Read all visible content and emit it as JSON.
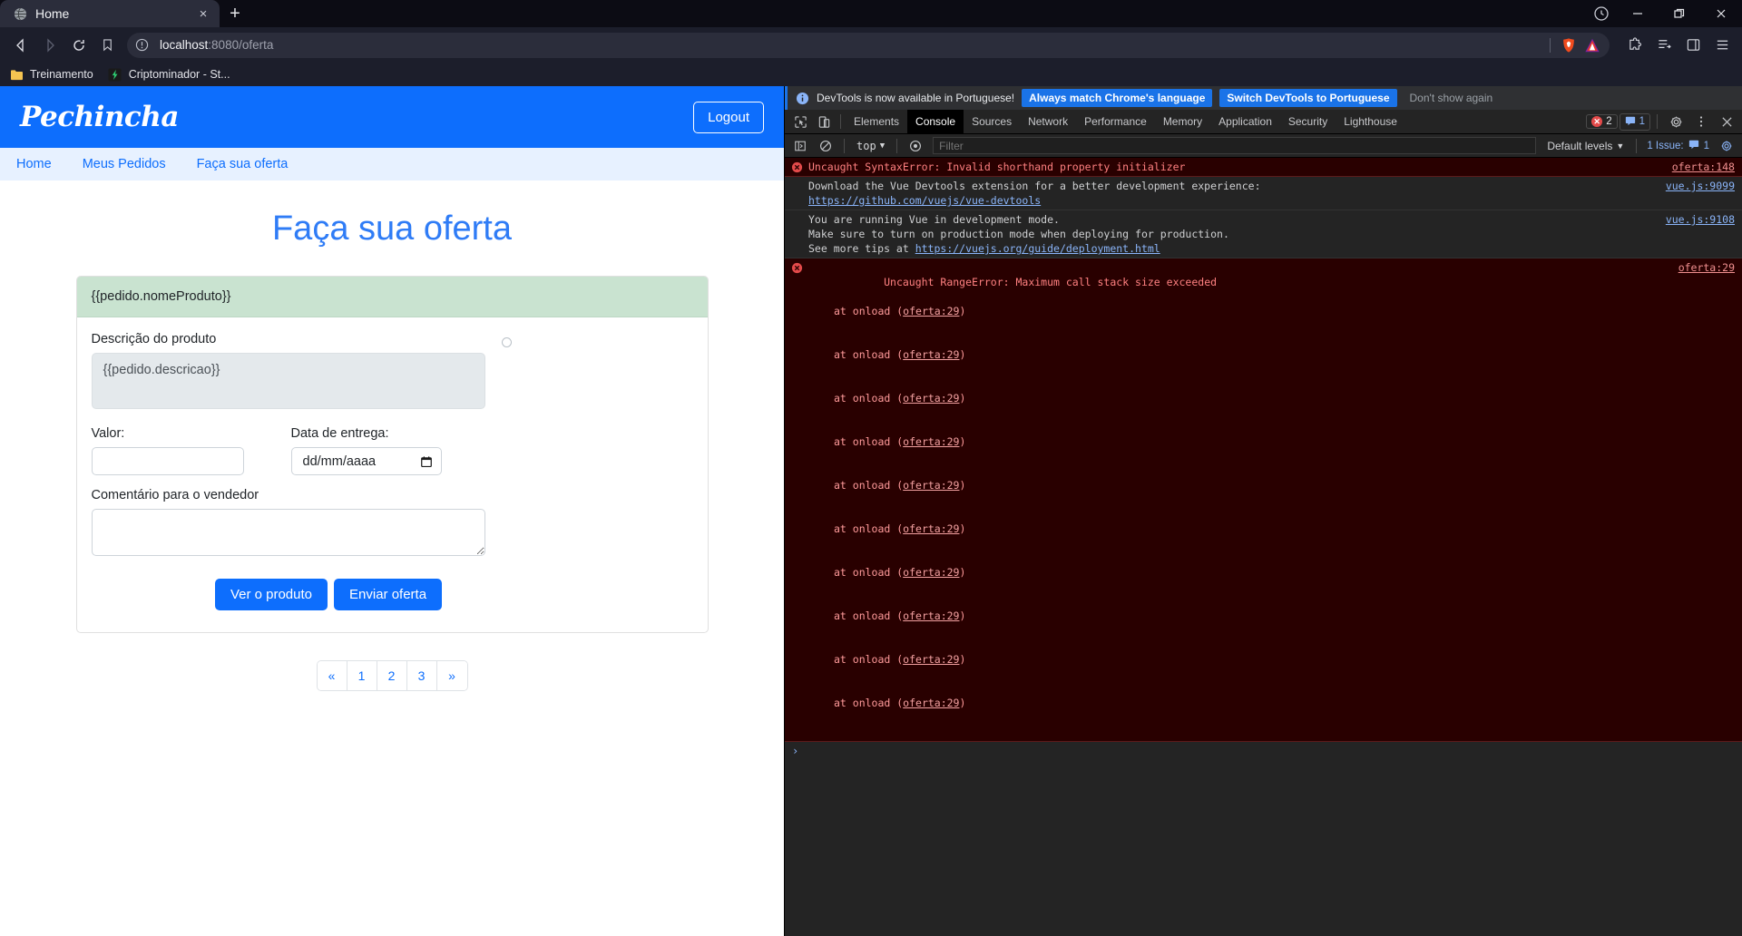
{
  "browser": {
    "tab": {
      "title": "Home",
      "favicon": "globe-icon",
      "close": "×"
    },
    "newtab_label": "+",
    "nav": {
      "back": "◁",
      "forward": "▷",
      "reload": "⟳"
    },
    "url": {
      "host": "localhost",
      "rest": ":8080/oferta",
      "full": "localhost:8080/oferta"
    },
    "window": {
      "minimize": "—",
      "maximize": "❐",
      "close": "✕"
    },
    "bookmarks": [
      {
        "label": "Treinamento",
        "icon": "folder-icon"
      },
      {
        "label": "Criptominador - St...",
        "icon": "lightning-icon"
      }
    ]
  },
  "page": {
    "brand": "Pechincha",
    "logout_label": "Logout",
    "nav_items": [
      {
        "label": "Home"
      },
      {
        "label": "Meus Pedidos"
      },
      {
        "label": "Faça sua oferta"
      }
    ],
    "title": "Faça sua oferta",
    "card": {
      "header": "{{pedido.nomeProduto}}",
      "description_label": "Descrição do produto",
      "description_value": "{{pedido.descricao}}",
      "valor_label": "Valor:",
      "valor_value": "",
      "valor_placeholder": "",
      "data_label": "Data de entrega:",
      "data_placeholder": "dd/mm/aaaa",
      "comentario_label": "Comentário para o vendedor",
      "comentario_value": "",
      "btn_ver": "Ver o produto",
      "btn_enviar": "Enviar oferta"
    },
    "pagination": [
      "«",
      "1",
      "2",
      "3",
      "»"
    ],
    "accent": "#0d6efd"
  },
  "devtools": {
    "banner": {
      "message": "DevTools is now available in Portuguese!",
      "btn_always": "Always match Chrome's language",
      "btn_switch": "Switch DevTools to Portuguese",
      "btn_dismiss": "Don't show again"
    },
    "tabs": [
      {
        "label": "Elements",
        "active": false
      },
      {
        "label": "Console",
        "active": true
      },
      {
        "label": "Sources",
        "active": false
      },
      {
        "label": "Network",
        "active": false
      },
      {
        "label": "Performance",
        "active": false
      },
      {
        "label": "Memory",
        "active": false
      },
      {
        "label": "Application",
        "active": false
      },
      {
        "label": "Security",
        "active": false
      },
      {
        "label": "Lighthouse",
        "active": false
      }
    ],
    "error_count": "2",
    "message_count": "1",
    "filterbar": {
      "context": "top",
      "filter_placeholder": "Filter",
      "levels": "Default levels",
      "issues": "1 Issue:",
      "issues_count": "1"
    },
    "messages": [
      {
        "type": "error",
        "text": "Uncaught SyntaxError: Invalid shorthand property initializer",
        "source": "oferta:148"
      },
      {
        "type": "info",
        "text": "Download the Vue Devtools extension for a better development experience:",
        "link": "https://github.com/vuejs/vue-devtools",
        "source": "vue.js:9099"
      },
      {
        "type": "info",
        "text": "You are running Vue in development mode.\nMake sure to turn on production mode when deploying for production.\nSee more tips at ",
        "link": "https://vuejs.org/guide/deployment.html",
        "source": "vue.js:9108"
      },
      {
        "type": "error",
        "text": "Uncaught RangeError: Maximum call stack size exceeded",
        "source": "oferta:29",
        "stack": [
          {
            "at": "at onload (",
            "link": "oferta:29",
            "close": ")"
          },
          {
            "at": "at onload (",
            "link": "oferta:29",
            "close": ")"
          },
          {
            "at": "at onload (",
            "link": "oferta:29",
            "close": ")"
          },
          {
            "at": "at onload (",
            "link": "oferta:29",
            "close": ")"
          },
          {
            "at": "at onload (",
            "link": "oferta:29",
            "close": ")"
          },
          {
            "at": "at onload (",
            "link": "oferta:29",
            "close": ")"
          },
          {
            "at": "at onload (",
            "link": "oferta:29",
            "close": ")"
          },
          {
            "at": "at onload (",
            "link": "oferta:29",
            "close": ")"
          },
          {
            "at": "at onload (",
            "link": "oferta:29",
            "close": ")"
          },
          {
            "at": "at onload (",
            "link": "oferta:29",
            "close": ")"
          }
        ]
      }
    ],
    "prompt_chevron": "›"
  }
}
